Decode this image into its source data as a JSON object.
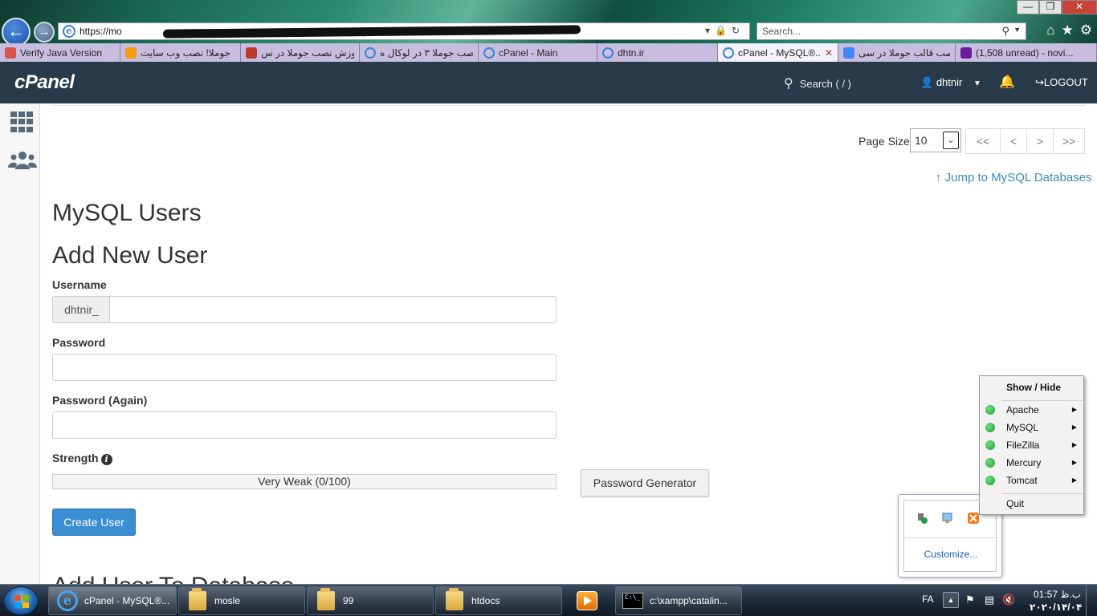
{
  "browser": {
    "window_buttons": {
      "minimize": "—",
      "maximize": "❐",
      "close": "✕"
    },
    "url": "https://mo                                                                                  mysqldbs",
    "search_placeholder": "Search...",
    "tabs": [
      {
        "label": "Verify Java Version",
        "icon": "java-icon",
        "active": false,
        "width": 150
      },
      {
        "label": "جوملا! نصب وب سایت",
        "icon": "joomla-icon",
        "active": false,
        "width": 150
      },
      {
        "label": "آموزش نصب جوملا در س...",
        "icon": "site-icon",
        "active": false,
        "width": 148
      },
      {
        "label": "نصب جوملا ۳ در لوکال ه...",
        "icon": "ie-icon",
        "active": false,
        "width": 148
      },
      {
        "label": "cPanel - Main",
        "icon": "ie-icon",
        "active": false,
        "width": 148
      },
      {
        "label": "dhtn.ir",
        "icon": "ie-icon",
        "active": false,
        "width": 150
      },
      {
        "label": "cPanel - MySQL®...",
        "icon": "ie-icon",
        "active": true,
        "width": 150
      },
      {
        "label": "نصب قالب جوملا در سی...",
        "icon": "google-icon",
        "active": false,
        "width": 146
      },
      {
        "label": "(1,508 unread) - novi...",
        "icon": "mail-icon",
        "active": false,
        "width": 176
      }
    ],
    "tab_close": "✕"
  },
  "cpanel": {
    "logo": "cPanel",
    "search_label": "Search ( / )",
    "username": "dhtnir",
    "logout": "LOGOUT",
    "page_size_label": "Page Size",
    "page_size_value": "10",
    "pager": [
      "<<",
      "<",
      ">",
      ">>"
    ],
    "jump_link": "Jump to MySQL Databases",
    "heading": "MySQL Users",
    "subheading": "Add New User",
    "username_label": "Username",
    "username_prefix": "dhtnir_",
    "password_label": "Password",
    "password_again_label": "Password (Again)",
    "strength_label": "Strength",
    "strength_value": "Very Weak (0/100)",
    "strength_fraction": 0,
    "password_generator": "Password Generator",
    "create_user": "Create User",
    "next_heading": "Add User To Database"
  },
  "xampp_menu": {
    "title": "Show / Hide",
    "services": [
      {
        "name": "Apache",
        "status_color": "#2ea84a"
      },
      {
        "name": "MySQL",
        "status_color": "#2ea84a"
      },
      {
        "name": "FileZilla",
        "status_color": "#2ea84a"
      },
      {
        "name": "Mercury",
        "status_color": "#2ea84a"
      },
      {
        "name": "Tomcat",
        "status_color": "#2ea84a"
      }
    ],
    "quit": "Quit",
    "customize": "Customize..."
  },
  "taskbar": {
    "items": [
      {
        "label": "cPanel - MySQL®...",
        "icon": "ie-icon",
        "active": true
      },
      {
        "label": "mosle",
        "icon": "folder-icon",
        "active": false
      },
      {
        "label": "99",
        "icon": "folder-icon",
        "active": false
      },
      {
        "label": "htdocs",
        "icon": "folder-icon",
        "active": false
      },
      {
        "label": "c:\\xampp\\catalin...",
        "icon": "cmd-icon",
        "active": false
      }
    ],
    "language": "FA",
    "time": "01:57 ب.ظ",
    "date": "۲۰۲۰/۱۴/۰۴"
  },
  "colors": {
    "cpanel_header": "#293a4a",
    "primary_button": "#3a8fd4",
    "link": "#3b88c8",
    "status_running": "#2ea84a"
  }
}
